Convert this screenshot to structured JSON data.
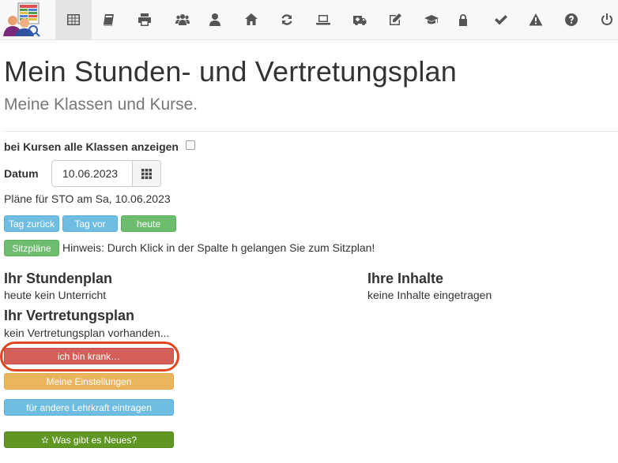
{
  "nav": {
    "items": [
      {
        "name": "table-icon",
        "active": true
      },
      {
        "name": "book-icon"
      },
      {
        "name": "print-icon"
      },
      {
        "name": "users-icon"
      },
      {
        "name": "user-icon"
      },
      {
        "name": "home-icon"
      },
      {
        "name": "refresh-icon"
      },
      {
        "name": "laptop-icon"
      },
      {
        "name": "ambulance-icon"
      },
      {
        "name": "edit-icon"
      },
      {
        "name": "graduation-cap-icon"
      },
      {
        "name": "lock-icon"
      },
      {
        "name": "check-icon"
      },
      {
        "name": "warning-icon"
      },
      {
        "name": "help-icon"
      },
      {
        "name": "power-icon"
      }
    ]
  },
  "header": {
    "title": "Mein Stunden- und Vertretungsplan",
    "subtitle": "Meine Klassen und Kurse."
  },
  "options": {
    "show_all_classes_label": "bei Kursen alle Klassen anzeigen",
    "show_all_classes_checked": false
  },
  "date": {
    "label": "Datum",
    "value": "10.06.2023"
  },
  "plans_info": "Pläne für STO am Sa, 10.06.2023",
  "nav_buttons": {
    "prev": "Tag zurück",
    "next": "Tag vor",
    "today": "heute"
  },
  "seating": {
    "button": "Sitzpläne",
    "hint": "Hinweis: Durch Klick in der Spalte h gelangen Sie zum Sitzplan!"
  },
  "timetable": {
    "title": "Ihr Stundenplan",
    "text": "heute kein Unterricht"
  },
  "contents": {
    "title": "Ihre Inhalte",
    "text": "keine Inhalte eingetragen"
  },
  "substitution": {
    "title": "Ihr Vertretungsplan",
    "text": "kein Vertretungsplan vorhanden..."
  },
  "actions": {
    "sick": "ich bin krank…",
    "settings": "Meine Einstellungen",
    "other_teacher": "für andere Lehrkraft eintragen",
    "news": "Was gibt es Neues?"
  },
  "colors": {
    "info": "#6fbde2",
    "success": "#6ebd6e",
    "danger": "#d45f58",
    "warning": "#ebb55d",
    "news": "#5f9722",
    "highlight": "#e0461f"
  }
}
